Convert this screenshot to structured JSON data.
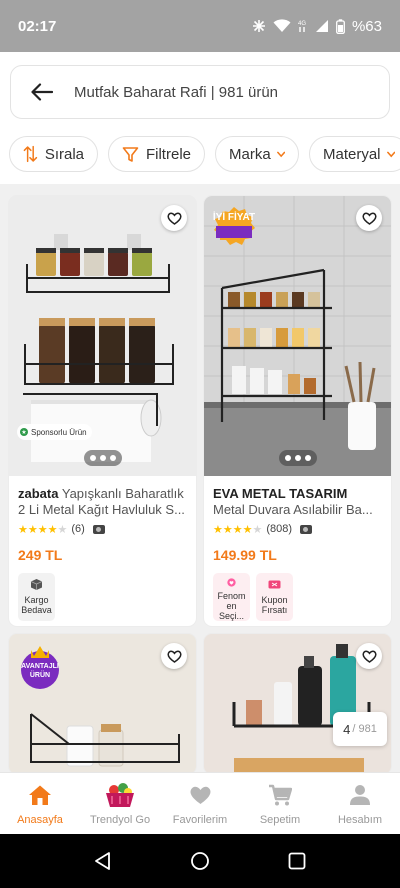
{
  "status": {
    "time": "02:17",
    "battery": "%63"
  },
  "search": {
    "title": "Mutfak Baharat Rafi | 981 ürün"
  },
  "filters": [
    {
      "label": "Sırala"
    },
    {
      "label": "Filtrele"
    },
    {
      "label": "Marka"
    },
    {
      "label": "Materyal"
    }
  ],
  "products": [
    {
      "brand": "zabata",
      "name": "Yapışkanlı Baharatlık 2 Li Metal Kağıt Havluluk S...",
      "name_line1": "Yapışkanlı Baharatlık",
      "name_line2": "2 Li Metal Kağıt Havluluk S...",
      "rating": 4,
      "reviews": "(6)",
      "price": "249 TL",
      "sponsored": "Sponsorlu Ürün",
      "tags": [
        {
          "label": "Kargo Bedava",
          "icon": "box-icon"
        }
      ]
    },
    {
      "brand": "EVA METAL TASARIM",
      "name": "Metal Duvara Asılabilir Ba...",
      "rating": 4,
      "reviews": "(808)",
      "price": "149.99 TL",
      "badge": "İYİ FİYAT",
      "tags": [
        {
          "label": "Fenom en Seçi...",
          "icon": "heart-badge-icon"
        },
        {
          "label": "Kupon Fırsatı",
          "icon": "coupon-icon"
        }
      ]
    },
    {
      "badge": "AVANTAJLI ÜRÜN"
    },
    {}
  ],
  "pagination": {
    "current": "4",
    "total": "/ 981"
  },
  "nav": [
    {
      "label": "Anasayfa",
      "icon": "home-icon",
      "active": true
    },
    {
      "label": "Trendyol Go",
      "icon": "grocery-basket-icon",
      "active": false
    },
    {
      "label": "Favorilerim",
      "icon": "heart-icon",
      "active": false
    },
    {
      "label": "Sepetim",
      "icon": "cart-icon",
      "active": false
    },
    {
      "label": "Hesabım",
      "icon": "user-icon",
      "active": false
    }
  ],
  "colors": {
    "accent": "#f27a1a",
    "statusbar": "#a3a3a3"
  }
}
